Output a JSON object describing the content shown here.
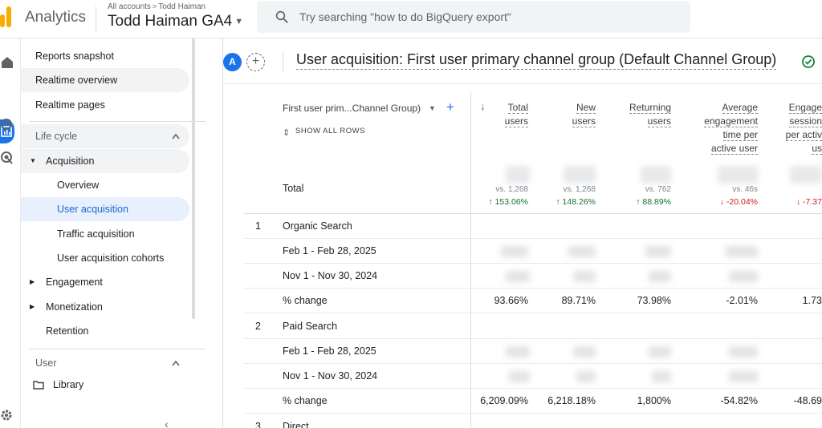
{
  "app": {
    "brand": "Analytics",
    "breadcrumb_all": "All accounts",
    "breadcrumb_account": "Todd Haiman",
    "property_name": "Todd Haiman GA4",
    "search_placeholder": "Try searching \"how to do BigQuery export\""
  },
  "sidebar": {
    "items": [
      {
        "label": "Reports snapshot"
      },
      {
        "label": "Realtime overview"
      },
      {
        "label": "Realtime pages"
      }
    ],
    "lifecycle_label": "Life cycle",
    "acquisition_label": "Acquisition",
    "acquisition_children": [
      {
        "label": "Overview"
      },
      {
        "label": "User acquisition"
      },
      {
        "label": "Traffic acquisition"
      },
      {
        "label": "User acquisition cohorts"
      }
    ],
    "engagement_label": "Engagement",
    "monetization_label": "Monetization",
    "retention_label": "Retention",
    "user_label": "User",
    "library_label": "Library"
  },
  "report": {
    "avatar_letter": "A",
    "title": "User acquisition: First user primary channel group (Default Channel Group)"
  },
  "table": {
    "dimension_header": "First user prim...Channel Group)",
    "show_all_rows": "SHOW ALL ROWS",
    "columns": [
      {
        "line1": "Total",
        "line2": "users",
        "line3": "",
        "line4": ""
      },
      {
        "line1": "New",
        "line2": "users",
        "line3": "",
        "line4": ""
      },
      {
        "line1": "Returning",
        "line2": "users",
        "line3": "",
        "line4": ""
      },
      {
        "line1": "Average",
        "line2": "engagement",
        "line3": "time per",
        "line4": "active user"
      },
      {
        "line1": "Engage",
        "line2": "session",
        "line3": "per activ",
        "line4": "us"
      }
    ],
    "total_label": "Total",
    "total_vs": [
      "vs. 1,268",
      "vs. 1,268",
      "vs. 762",
      "vs. 46s",
      ""
    ],
    "total_changes": [
      {
        "text": "↑ 153.06%",
        "dir": "up"
      },
      {
        "text": "↑ 148.26%",
        "dir": "up"
      },
      {
        "text": "↑ 88.89%",
        "dir": "up"
      },
      {
        "text": "↓ -20.04%",
        "dir": "down"
      },
      {
        "text": "↓ -7.37",
        "dir": "down"
      }
    ],
    "groups": [
      {
        "num": "1",
        "name": "Organic Search",
        "range_a": "Feb 1 - Feb 28, 2025",
        "range_b": "Nov 1 - Nov 30, 2024",
        "change_label": "% change",
        "changes": [
          "93.66%",
          "89.71%",
          "73.98%",
          "-2.01%",
          "1.73"
        ]
      },
      {
        "num": "2",
        "name": "Paid Search",
        "range_a": "Feb 1 - Feb 28, 2025",
        "range_b": "Nov 1 - Nov 30, 2024",
        "change_label": "% change",
        "changes": [
          "6,209.09%",
          "6,218.18%",
          "1,800%",
          "-54.82%",
          "-48.69"
        ]
      },
      {
        "num": "3",
        "name": "Direct"
      }
    ]
  }
}
